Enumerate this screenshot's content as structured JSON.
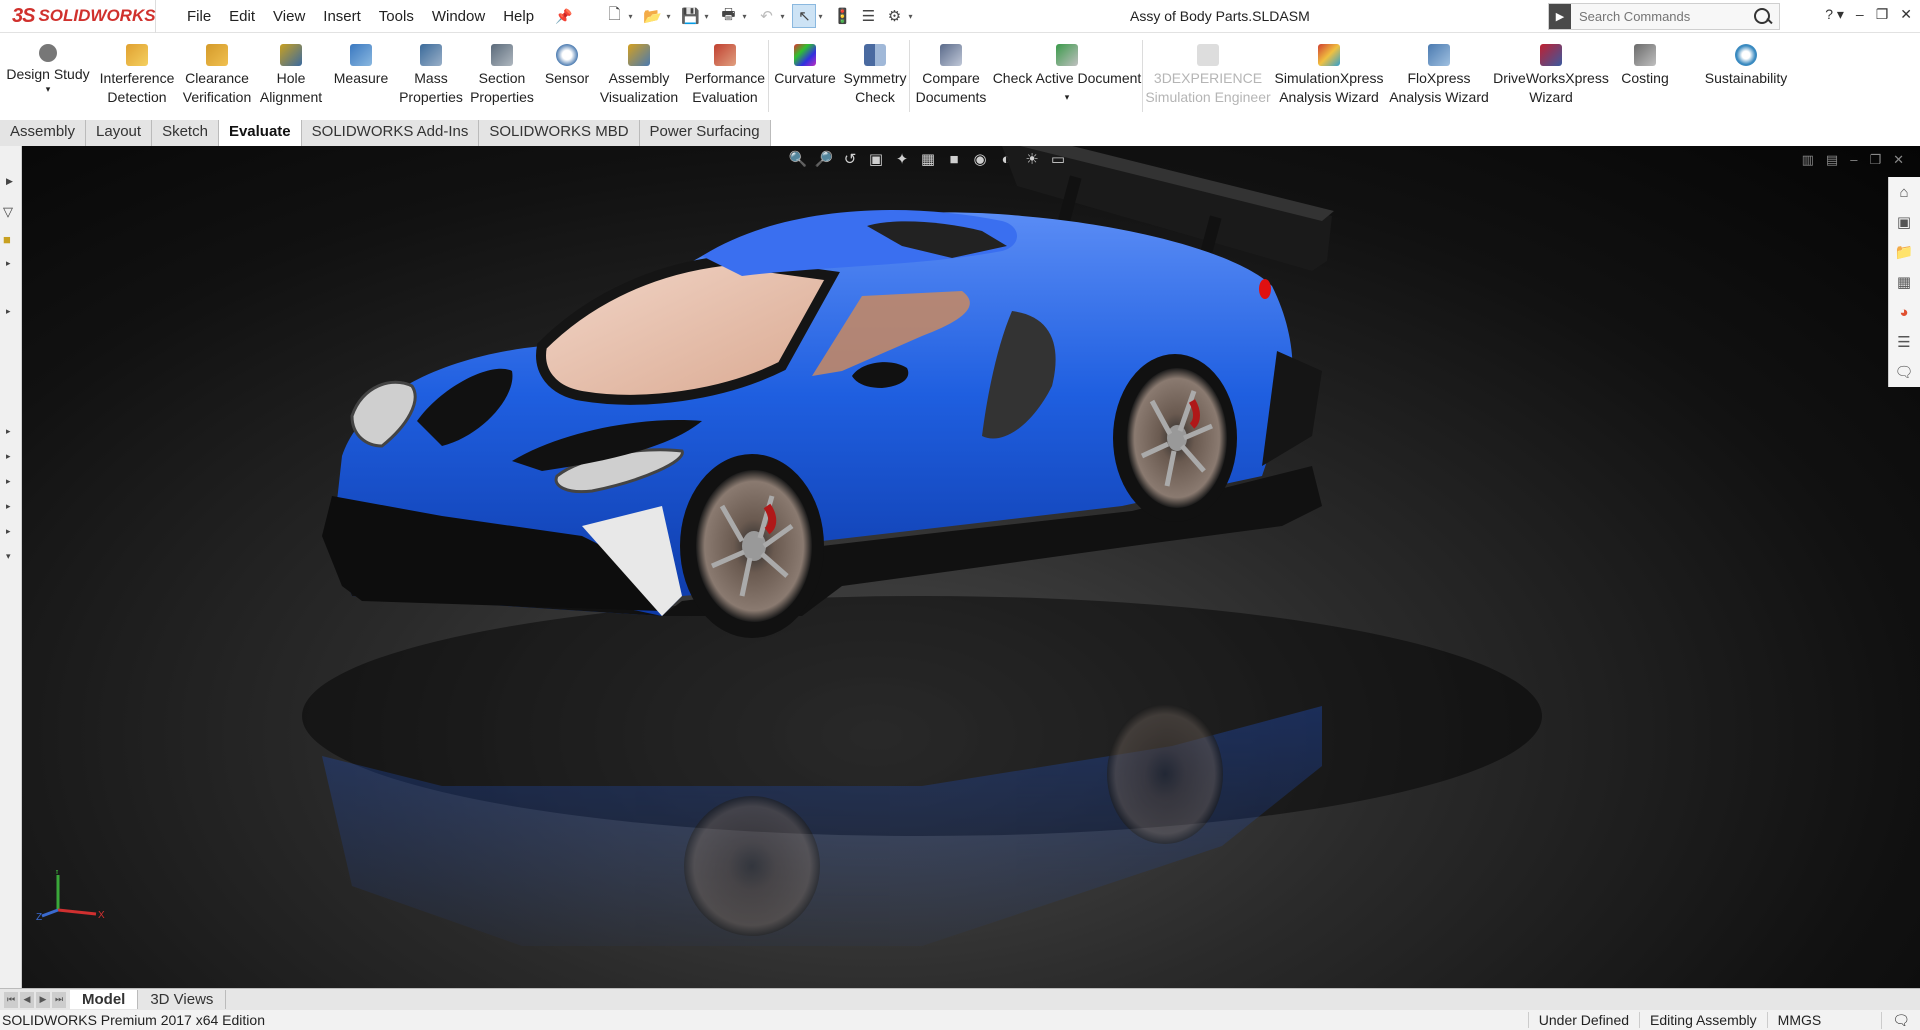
{
  "app": {
    "logo_text": "SOLIDWORKS",
    "document_title": "Assy of Body Parts.SLDASM"
  },
  "menu": [
    "File",
    "Edit",
    "View",
    "Insert",
    "Tools",
    "Window",
    "Help"
  ],
  "search": {
    "placeholder": "Search Commands"
  },
  "ribbon": [
    {
      "label": "Design Study",
      "icon": "design-study-icon",
      "color": "#555555"
    },
    {
      "label": "Interference\nDetection",
      "icon": "interference-detection-icon",
      "color": "#e0a030"
    },
    {
      "label": "Clearance\nVerification",
      "icon": "clearance-verification-icon",
      "color": "#d49a2a"
    },
    {
      "label": "Hole\nAlignment",
      "icon": "hole-alignment-icon",
      "color": "#c8a020"
    },
    {
      "label": "Measure",
      "icon": "measure-icon",
      "color": "#3a78c0"
    },
    {
      "label": "Mass\nProperties",
      "icon": "mass-properties-icon",
      "color": "#3a6a9a"
    },
    {
      "label": "Section\nProperties",
      "icon": "section-properties-icon",
      "color": "#5a6a7a"
    },
    {
      "label": "Sensor",
      "icon": "sensor-icon",
      "color": "#4a7ab0"
    },
    {
      "label": "Assembly\nVisualization",
      "icon": "assembly-visualization-icon",
      "color": "#d4a020"
    },
    {
      "label": "Performance\nEvaluation",
      "icon": "performance-evaluation-icon",
      "color": "#c04030"
    },
    {
      "label": "Curvature",
      "icon": "curvature-icon",
      "color": "#c030c0"
    },
    {
      "label": "Symmetry\nCheck",
      "icon": "symmetry-check-icon",
      "color": "#4a6aa0"
    },
    {
      "label": "Compare\nDocuments",
      "icon": "compare-documents-icon",
      "color": "#5a6a8a"
    },
    {
      "label": "Check Active Document",
      "icon": "check-active-document-icon",
      "color": "#3a9a4a"
    },
    {
      "label": "3DEXPERIENCE\nSimulation Engineer",
      "icon": "3dexperience-icon",
      "color": "#bbbbbb",
      "disabled": true
    },
    {
      "label": "SimulationXpress\nAnalysis Wizard",
      "icon": "simulationxpress-icon",
      "color": "#d04030"
    },
    {
      "label": "FloXpress\nAnalysis Wizard",
      "icon": "floxpress-icon",
      "color": "#4a7ab0"
    },
    {
      "label": "DriveWorksXpress\nWizard",
      "icon": "driveworksxpress-icon",
      "color": "#c02030"
    },
    {
      "label": "Costing",
      "icon": "costing-icon",
      "color": "#6a6a6a"
    },
    {
      "label": "Sustainability",
      "icon": "sustainability-icon",
      "color": "#3a8ac0"
    }
  ],
  "tabs": [
    {
      "label": "Assembly",
      "active": false
    },
    {
      "label": "Layout",
      "active": false
    },
    {
      "label": "Sketch",
      "active": false
    },
    {
      "label": "Evaluate",
      "active": true
    },
    {
      "label": "SOLIDWORKS Add-Ins",
      "active": false
    },
    {
      "label": "SOLIDWORKS MBD",
      "active": false
    },
    {
      "label": "Power Surfacing",
      "active": false
    }
  ],
  "bottom_tabs": [
    {
      "label": "Model",
      "active": true
    },
    {
      "label": "3D Views",
      "active": false
    }
  ],
  "status": {
    "edition": "SOLIDWORKS Premium 2017 x64 Edition",
    "definition": "Under Defined",
    "mode": "Editing Assembly",
    "units": "MMGS"
  },
  "colors": {
    "body": "#1f5fe0",
    "brand": "#d0312d"
  }
}
